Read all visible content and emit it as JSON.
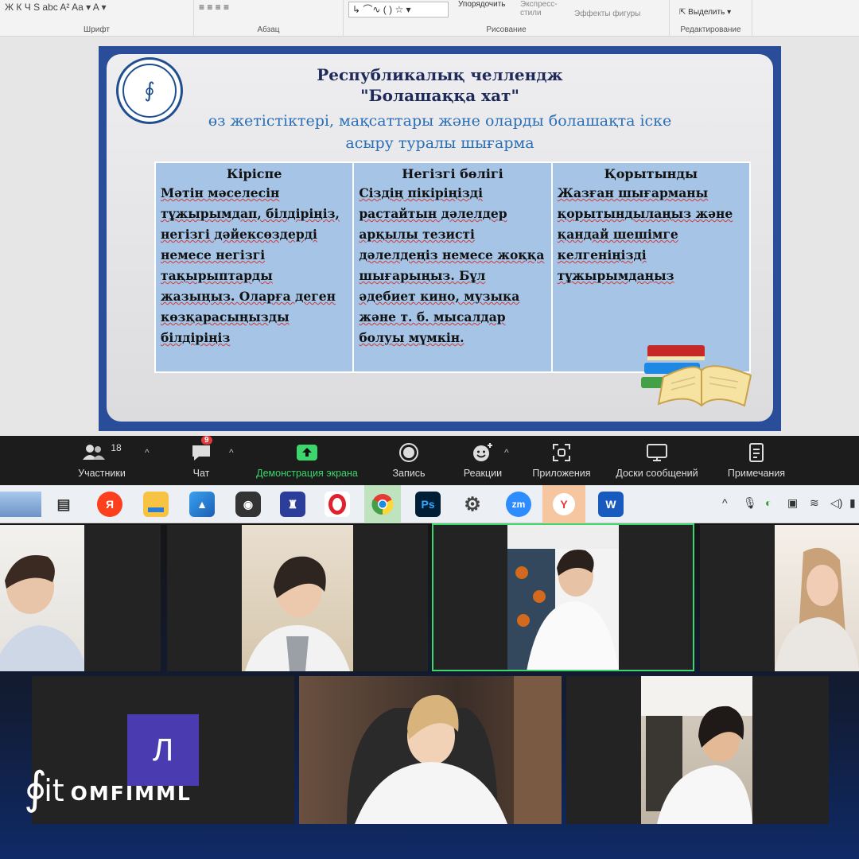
{
  "ribbon": {
    "font_tools": "Ж  К  Ч  S  abc  A²  Aa ▾   A ▾",
    "para_tools": "≡  ≡  ≡  ≡",
    "groups": {
      "font": "Шрифт",
      "paragraph": "Абзац",
      "drawing": "Рисование",
      "editing": "Редактирование"
    },
    "arrange": "Упорядочить",
    "quick_styles": "Экспресс-стили",
    "shape_effects": "Эффекты фигуры",
    "select": "Выделить"
  },
  "slide": {
    "title_line1": "Республикалық челлендж",
    "title_line2": "\"Болашаққа хат\"",
    "subtitle": "өз жетістіктері, мақсаттары және оларды болашақта іске асыру туралы шығарма",
    "columns": [
      {
        "heading": "Кіріспе",
        "text": "Мәтін мәселесін тұжырымдап, білдіріңіз, негізгі дәйексөздерді немесе негізгі тақырыптарды жазыңыз. Оларға деген көзқарасыңызды білдіріңіз"
      },
      {
        "heading": "Негізгі бөлігі",
        "text": "Сіздің пікіріңізді растайтын дәлелдер арқылы тезисті дәлелдеңіз немесе жоққа шығарыңыз. Бұл әдебиет кино, музыка және т. б. мысалдар болуы мүмкін."
      },
      {
        "heading": "Қорытынды",
        "text": "Жазған шығарманы қорытындылаңыз және қандай шешімге келгеніңізді тұжырымдаңыз"
      }
    ]
  },
  "zoom": {
    "participants_label": "Участники",
    "participants_count": "18",
    "chat_label": "Чат",
    "chat_badge": "9",
    "share_label": "Демонстрация экрана",
    "record_label": "Запись",
    "reactions_label": "Реакции",
    "apps_label": "Приложения",
    "whiteboards_label": "Доски сообщений",
    "notes_label": "Примечания"
  },
  "taskbar": {
    "icons": [
      "widgets-icon",
      "task-view-icon",
      "yandex-icon",
      "file-explorer-icon",
      "photos-icon",
      "app-shield-icon",
      "app-crest-icon",
      "opera-icon",
      "chrome-icon",
      "photoshop-icon",
      "settings-icon",
      "zoom-icon",
      "yandex-browser-icon",
      "word-icon"
    ],
    "yandex_glyph": "Я",
    "ps_glyph": "Ps",
    "zoom_glyph": "zm",
    "word_glyph": "W",
    "yb_glyph": "Y"
  },
  "gallery": {
    "initial_avatar": "Л",
    "brand_name": "OMFIMML",
    "brand_it": "it"
  },
  "colors": {
    "zoom_green": "#3cd66c",
    "slide_frame": "#2a4d9a",
    "table_cell": "#a5c4e6",
    "avatar_bg": "#4a3bb0"
  }
}
